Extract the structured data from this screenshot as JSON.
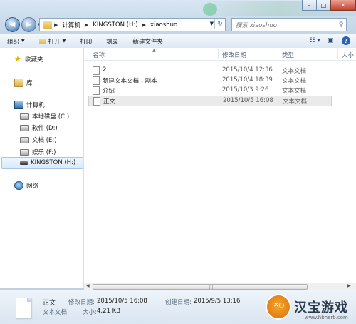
{
  "window_controls": {
    "minimize": "–",
    "maximize": "□",
    "close": "✕"
  },
  "address_bar": {
    "path": [
      "计算机",
      "KINGSTON (H:)",
      "xiaoshuo"
    ]
  },
  "search": {
    "placeholder": "搜索 xiaoshuo"
  },
  "toolbar": {
    "organize": "组织",
    "open": "打开",
    "print": "打印",
    "burn": "刻录",
    "new_folder": "新建文件夹"
  },
  "nav_pane": {
    "favorites": "收藏夹",
    "libraries": "库",
    "computer": "计算机",
    "drives": [
      {
        "label": "本地磁盘 (C:)"
      },
      {
        "label": "软件 (D:)"
      },
      {
        "label": "文档 (E:)"
      },
      {
        "label": "娱乐 (F:)"
      },
      {
        "label": "KINGSTON (H:)"
      }
    ],
    "network": "网络"
  },
  "columns": {
    "name": "名称",
    "modified": "修改日期",
    "type": "类型",
    "size": "大小"
  },
  "files": [
    {
      "name": "2",
      "modified": "2015/10/4 12:36",
      "type": "文本文档"
    },
    {
      "name": "新建文本文档 - 副本",
      "modified": "2015/10/4 18:39",
      "type": "文本文档"
    },
    {
      "name": "介绍",
      "modified": "2015/10/3 9:26",
      "type": "文本文档"
    },
    {
      "name": "正文",
      "modified": "2015/10/5 16:08",
      "type": "文本文档"
    }
  ],
  "details": {
    "filename": "正文",
    "filetype": "文本文档",
    "modified_label": "修改日期:",
    "modified_value": "2015/10/5 16:08",
    "created_label": "创建日期:",
    "created_value": "2015/9/5 13:16",
    "size_label": "大小:",
    "size_value": "4.21 KB"
  },
  "watermark": {
    "text": "汉宝游戏",
    "url": "www.hbherb.com"
  }
}
